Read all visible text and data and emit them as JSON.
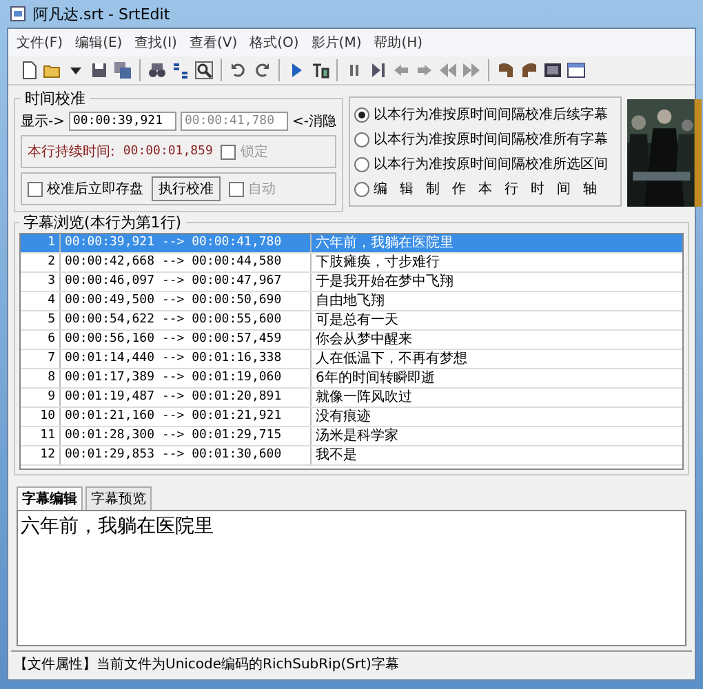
{
  "window": {
    "title": "阿凡达.srt - SrtEdit"
  },
  "menu": [
    "文件(F)",
    "编辑(E)",
    "查找(I)",
    "查看(V)",
    "格式(O)",
    "影片(M)",
    "帮助(H)"
  ],
  "time_calibration": {
    "title": "时间校准",
    "show_label": "显示->",
    "start_value": "00:00:39,921",
    "end_value": "00:00:41,780",
    "hide_label": "<-消隐",
    "duration_label": "本行持续时间:",
    "duration_value": "00:00:01,859",
    "lock": {
      "label": "锁定",
      "checked": false,
      "disabled": true
    },
    "save_after": {
      "label": "校准后立即存盘",
      "checked": false
    },
    "run_button": "执行校准",
    "auto": {
      "label": "自动",
      "checked": false,
      "disabled": true
    }
  },
  "modes": [
    {
      "label": "以本行为准按原时间间隔校准后续字幕",
      "selected": true,
      "spread": false
    },
    {
      "label": "以本行为准按原时间间隔校准所有字幕",
      "selected": false,
      "spread": false
    },
    {
      "label": "以本行为准按原时间间隔校准所选区间",
      "selected": false,
      "spread": false
    },
    {
      "label": "编辑制作本行时间轴",
      "selected": false,
      "spread": true
    }
  ],
  "browse": {
    "title": "字幕浏览(本行为第1行)",
    "rows": [
      {
        "index": "1",
        "time": "00:00:39,921 --> 00:00:41,780",
        "text": "六年前，我躺在医院里",
        "selected": true
      },
      {
        "index": "2",
        "time": "00:00:42,668 --> 00:00:44,580",
        "text": "下肢瘫痪，寸步难行",
        "selected": false
      },
      {
        "index": "3",
        "time": "00:00:46,097 --> 00:00:47,967",
        "text": "于是我开始在梦中飞翔",
        "selected": false
      },
      {
        "index": "4",
        "time": "00:00:49,500 --> 00:00:50,690",
        "text": "自由地飞翔",
        "selected": false
      },
      {
        "index": "5",
        "time": "00:00:54,622 --> 00:00:55,600",
        "text": "可是总有一天",
        "selected": false
      },
      {
        "index": "6",
        "time": "00:00:56,160 --> 00:00:57,459",
        "text": "你会从梦中醒来",
        "selected": false
      },
      {
        "index": "7",
        "time": "00:01:14,440 --> 00:01:16,338",
        "text": "人在低温下，不再有梦想",
        "selected": false
      },
      {
        "index": "8",
        "time": "00:01:17,389 --> 00:01:19,060",
        "text": "6年的时间转瞬即逝",
        "selected": false
      },
      {
        "index": "9",
        "time": "00:01:19,487 --> 00:01:20,891",
        "text": "就像一阵风吹过",
        "selected": false
      },
      {
        "index": "10",
        "time": "00:01:21,160 --> 00:01:21,921",
        "text": "没有痕迹",
        "selected": false
      },
      {
        "index": "11",
        "time": "00:01:28,300 --> 00:01:29,715",
        "text": "汤米是科学家",
        "selected": false
      },
      {
        "index": "12",
        "time": "00:01:29,853 --> 00:01:30,600",
        "text": "我不是",
        "selected": false
      }
    ]
  },
  "tabs": [
    {
      "label": "字幕编辑",
      "selected": true
    },
    {
      "label": "字幕预览",
      "selected": false
    }
  ],
  "editor": {
    "value": "六年前，我躺在医院里"
  },
  "status_bar": "【文件属性】当前文件为Unicode编码的RichSubRip(Srt)字幕"
}
